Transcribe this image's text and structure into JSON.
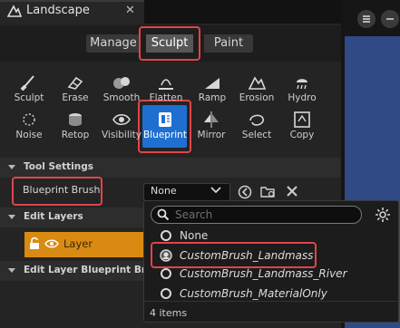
{
  "window": {
    "tab_title": "Landscape",
    "tab_close": "✕"
  },
  "modes": {
    "manage": "Manage",
    "sculpt": "Sculpt",
    "paint": "Paint"
  },
  "tools": [
    {
      "label": "Sculpt",
      "icon": "sculpt-brush-icon"
    },
    {
      "label": "Erase",
      "icon": "erase-icon"
    },
    {
      "label": "Smooth",
      "icon": "smooth-icon"
    },
    {
      "label": "Flatten",
      "icon": "flatten-icon"
    },
    {
      "label": "Ramp",
      "icon": "ramp-icon"
    },
    {
      "label": "Erosion",
      "icon": "erosion-icon"
    },
    {
      "label": "Hydro",
      "icon": "hydro-icon"
    },
    {
      "label": "Noise",
      "icon": "noise-icon"
    },
    {
      "label": "Retop",
      "icon": "retop-icon"
    },
    {
      "label": "Visibility",
      "icon": "visibility-eye-icon"
    },
    {
      "label": "Blueprint",
      "icon": "blueprint-icon"
    },
    {
      "label": "Mirror",
      "icon": "mirror-icon"
    },
    {
      "label": "Select",
      "icon": "select-icon"
    },
    {
      "label": "Copy",
      "icon": "copy-icon"
    }
  ],
  "sections": {
    "tool_settings": "Tool Settings",
    "edit_layers": "Edit Layers",
    "edit_layer_blueprint": "Edit Layer Blueprint Brushe"
  },
  "blueprint_brush": {
    "label": "Blueprint Brush",
    "value": "None"
  },
  "layer": {
    "name": "Layer"
  },
  "popup": {
    "search_placeholder": "Search",
    "options": [
      "None",
      "CustomBrush_Landmass",
      "CustomBrush_Landmass_River",
      "CustomBrush_MaterialOnly"
    ],
    "count": "4 items"
  },
  "colors": {
    "accent_blue": "#1f6fd1",
    "highlight_red": "#e0444b",
    "layer_orange": "#d98a12"
  }
}
